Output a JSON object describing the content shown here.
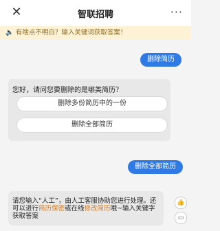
{
  "header": {
    "close_icon": "close-icon",
    "title": "智联招聘",
    "more_icon": "more-icon",
    "more_glyph": "···"
  },
  "notice": {
    "icon": "speaker-icon",
    "text": "有啥点不明白？输入关键词获取答案！"
  },
  "messages": {
    "user_1": "删除简历",
    "bot_question": "您好，请问您要删除的是哪类简历？",
    "option_1": "删除多份简历中的一份",
    "option_2": "删除全部简历",
    "user_2": "删除全部简历",
    "bot_reply": {
      "part_1": "请您输入“人工”，由人工客服协助您进行处理。还可以进行",
      "link_1": "简历保密",
      "part_2": "或在线",
      "link_2": "修改简历",
      "part_3": "哦~输入关键字获取答案"
    }
  },
  "side_buttons": {
    "like_icon": "thumbs-up-icon",
    "comment_icon": "comment-icon",
    "like_glyph": "👍",
    "comment_glyph": "▭"
  }
}
